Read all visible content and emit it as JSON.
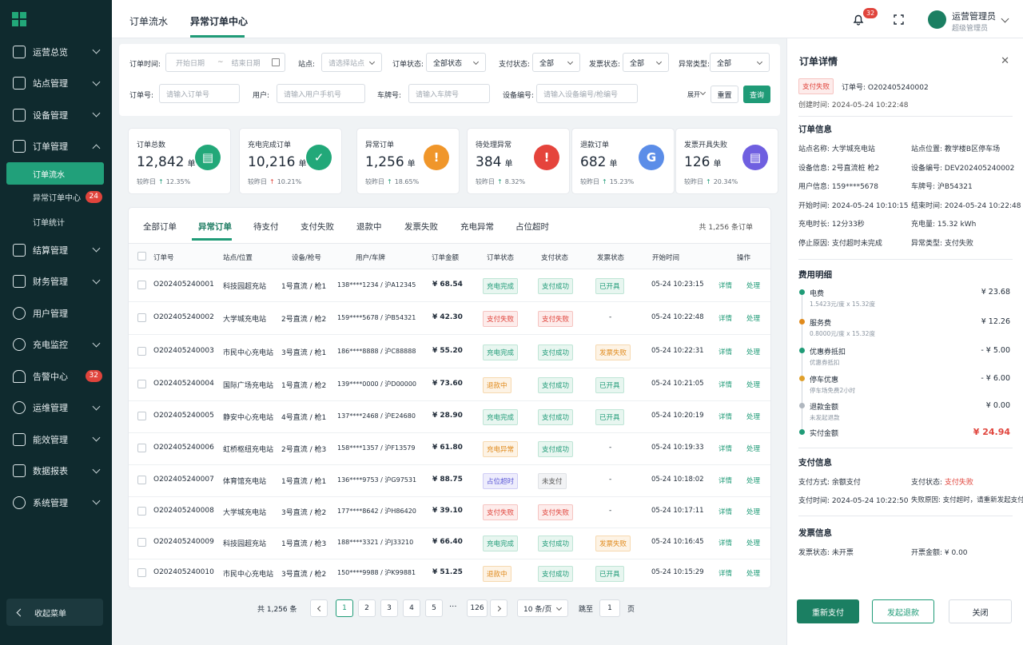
{
  "sidebar": {
    "items": [
      {
        "label": "运营总览",
        "icon": "dashboard-icon"
      },
      {
        "label": "站点管理",
        "icon": "station-icon"
      },
      {
        "label": "设备管理",
        "icon": "device-icon"
      },
      {
        "label": "订单管理",
        "icon": "order-icon"
      },
      {
        "label": "结算管理",
        "icon": "settlement-icon"
      },
      {
        "label": "财务管理",
        "icon": "finance-icon"
      },
      {
        "label": "用户管理",
        "icon": "user-icon"
      },
      {
        "label": "充电监控",
        "icon": "monitor-icon"
      },
      {
        "label": "告警中心",
        "icon": "alarm-icon",
        "badge": "32"
      },
      {
        "label": "运维管理",
        "icon": "maintenance-icon"
      },
      {
        "label": "能效管理",
        "icon": "energy-icon"
      },
      {
        "label": "数据报表",
        "icon": "report-icon"
      },
      {
        "label": "系统管理",
        "icon": "settings-icon"
      }
    ],
    "sub": [
      {
        "label": "订单流水"
      },
      {
        "label": "异常订单中心",
        "badge": "24"
      },
      {
        "label": "订单统计"
      }
    ],
    "collapse": "收起菜单"
  },
  "topbar": {
    "tabs": [
      "订单流水",
      "异常订单中心"
    ],
    "bell_badge": "32",
    "user_name": "运营管理员",
    "user_role": "超级管理员"
  },
  "filters": {
    "time_label": "订单时间:",
    "start_ph": "开始日期",
    "end_ph": "结束日期",
    "station_label": "站点:",
    "station_ph": "请选择站点",
    "status_label": "订单状态:",
    "status_val": "全部状态",
    "pay_label": "支付状态:",
    "pay_val": "全部",
    "invoice_label": "发票状态:",
    "invoice_val": "全部",
    "abn_label": "异常类型:",
    "abn_val": "全部",
    "order_label": "订单号:",
    "order_ph": "请输入订单号",
    "user_label": "用户:",
    "user_ph": "请输入用户手机号",
    "plate_label": "车牌号:",
    "plate_ph": "请输入车牌号",
    "dev_label": "设备编号:",
    "dev_ph": "请输入设备编号/枪编号",
    "expand": "展开",
    "reset": "重置",
    "query": "查询"
  },
  "cards": [
    {
      "title": "订单总数",
      "value": "12,842",
      "unit": "单",
      "cmp": "较昨日",
      "dir": "↑",
      "pct": "12.35%",
      "color": "#22a879",
      "icon": "clipboard-icon",
      "glyph": "▤"
    },
    {
      "title": "充电完成订单",
      "value": "10,216",
      "unit": "单",
      "cmp": "较昨日",
      "dir": "↑",
      "pct": "10.21%",
      "color": "#22a879",
      "icon": "check-circle-icon",
      "glyph": "✓",
      "red": true
    },
    {
      "title": "异常订单",
      "value": "1,256",
      "unit": "单",
      "cmp": "较昨日",
      "dir": "↑",
      "pct": "18.65%",
      "color": "#f0962a",
      "icon": "warning-icon",
      "glyph": "!"
    },
    {
      "title": "待处理异常",
      "value": "384",
      "unit": "单",
      "cmp": "较昨日",
      "dir": "↑",
      "pct": "8.32%",
      "color": "#e5443c",
      "icon": "alert-icon",
      "glyph": "!"
    },
    {
      "title": "退款订单",
      "value": "682",
      "unit": "单",
      "cmp": "较昨日",
      "dir": "↑",
      "pct": "15.23%",
      "color": "#5b8de8",
      "icon": "refund-icon",
      "glyph": "G"
    },
    {
      "title": "发票开具失败",
      "value": "126",
      "unit": "单",
      "cmp": "较昨日",
      "dir": "↑",
      "pct": "20.34%",
      "color": "#6f5fe0",
      "icon": "invoice-icon",
      "glyph": "▤"
    }
  ],
  "table": {
    "tabs": [
      "全部订单",
      "异常订单",
      "待支付",
      "支付失败",
      "退款中",
      "发票失败",
      "充电异常",
      "占位超时"
    ],
    "total": "共 1,256 条订单",
    "headers": [
      "订单号",
      "站点/位置",
      "设备/枪号",
      "用户/车牌",
      "订单金额",
      "订单状态",
      "支付状态",
      "发票状态",
      "开始时间",
      "操作"
    ],
    "rows": [
      [
        "O202405240001",
        "科技园超充站",
        "1号直流 / 枪1",
        "138****1234 / 沪A12345",
        "¥ 68.54",
        "充电完成",
        "g",
        "支付成功",
        "g",
        "已开具",
        "g",
        "05-24 10:23:15"
      ],
      [
        "O202405240002",
        "大学城充电站",
        "2号直流 / 枪2",
        "159****5678 / 沪B54321",
        "¥ 42.30",
        "支付失败",
        "r",
        "支付失败",
        "r",
        "-",
        "n",
        "05-24 10:22:48"
      ],
      [
        "O202405240003",
        "市民中心充电站",
        "3号直流 / 枪1",
        "186****8888 / 沪C88888",
        "¥ 55.20",
        "充电完成",
        "g",
        "支付成功",
        "g",
        "发票失败",
        "o",
        "05-24 10:22:31"
      ],
      [
        "O202405240004",
        "国际广场充电站",
        "1号直流 / 枪2",
        "139****0000 / 沪D00000",
        "¥ 73.60",
        "退款中",
        "o",
        "支付成功",
        "g",
        "已开具",
        "g",
        "05-24 10:21:05"
      ],
      [
        "O202405240005",
        "静安中心充电站",
        "4号直流 / 枪1",
        "137****2468 / 沪E24680",
        "¥ 28.90",
        "充电完成",
        "g",
        "支付成功",
        "g",
        "已开具",
        "g",
        "05-24 10:20:19"
      ],
      [
        "O202405240006",
        "虹桥枢纽充电站",
        "2号直流 / 枪3",
        "158****1357 / 沪F13579",
        "¥ 61.80",
        "充电异常",
        "o",
        "支付成功",
        "g",
        "-",
        "n",
        "05-24 10:19:33"
      ],
      [
        "O202405240007",
        "体育馆充电站",
        "1号直流 / 枪1",
        "136****9753 / 沪G97531",
        "¥ 88.75",
        "占位超时",
        "p",
        "未支付",
        "gr",
        "-",
        "n",
        "05-24 10:18:02"
      ],
      [
        "O202405240008",
        "大学城充电站",
        "3号直流 / 枪2",
        "177****8642 / 沪H86420",
        "¥ 39.10",
        "支付失败",
        "r",
        "支付失败",
        "r",
        "-",
        "n",
        "05-24 10:17:11"
      ],
      [
        "O202405240009",
        "科技园超充站",
        "1号直流 / 枪3",
        "188****3321 / 沪J33210",
        "¥ 66.40",
        "充电完成",
        "g",
        "支付成功",
        "g",
        "发票失败",
        "o",
        "05-24 10:16:45"
      ],
      [
        "O202405240010",
        "市民中心充电站",
        "3号直流 / 枪2",
        "150****9988 / 沪K99881",
        "¥ 51.25",
        "退款中",
        "o",
        "支付成功",
        "g",
        "已开具",
        "g",
        "05-24 10:15:29"
      ]
    ],
    "detail_link": "详情",
    "handle_link": "处理"
  },
  "pagination": {
    "total": "共 1,256 条",
    "pages": [
      "1",
      "2",
      "3",
      "4",
      "5"
    ],
    "ellipsis": "···",
    "last": "126",
    "size": "10 条/页",
    "goto": "跳至",
    "goto_val": "1",
    "page_unit": "页"
  },
  "detail": {
    "title": "订单详情",
    "status_tag": "支付失败",
    "order_no": "订单号: O202405240002",
    "created": "创建时间: 2024-05-24 10:22:48",
    "info_title": "订单信息",
    "info": [
      [
        "站点名称: 大学城充电站",
        "站点位置: 教学楼B区停车场"
      ],
      [
        "设备信息: 2号直流桩  枪2",
        "设备编号: DEV202405240002"
      ],
      [
        "用户信息: 159****5678",
        "车牌号: 沪B54321"
      ],
      [
        "开始时间: 2024-05-24 10:10:15",
        "结束时间: 2024-05-24 10:22:48"
      ],
      [
        "充电时长: 12分33秒",
        "充电量: 15.32 kWh"
      ],
      [
        "停止原因: 支付超时未完成",
        "异常类型: 支付失败"
      ]
    ],
    "fee_title": "费用明细",
    "fees": [
      {
        "name": "电费",
        "sub": "1.5423元/度 x 15.32度",
        "amt": "¥ 23.68",
        "color": "#1f9b77"
      },
      {
        "name": "服务费",
        "sub": "0.8000元/度 x 15.32度",
        "amt": "¥ 12.26",
        "color": "#e08a1c"
      },
      {
        "name": "优惠券抵扣",
        "sub": "优惠券抵扣",
        "amt": "- ¥ 5.00",
        "color": "#1f9b77"
      },
      {
        "name": "停车优惠",
        "sub": "停车场免费2小时",
        "amt": "- ¥ 6.00",
        "color": "#e0a02c"
      },
      {
        "name": "退款金额",
        "sub": "未发起退款",
        "amt": "¥ 0.00",
        "color": "#b0b7bf"
      }
    ],
    "paid_label": "实付金额",
    "paid_amt": "¥ 24.94",
    "pay_title": "支付信息",
    "pay_method": "支付方式: 余额支付",
    "pay_status_label": "支付状态: ",
    "pay_status": "支付失败",
    "pay_time": "支付时间: 2024-05-24 10:22:50",
    "fail_reason": "失败原因: 支付超时，请重新发起支付",
    "inv_title": "发票信息",
    "inv_status": "发票状态: 未开票",
    "inv_amt": "开票金额: ¥ 0.00",
    "btn_repay": "重新支付",
    "btn_refund": "发起退款",
    "btn_close": "关闭"
  }
}
